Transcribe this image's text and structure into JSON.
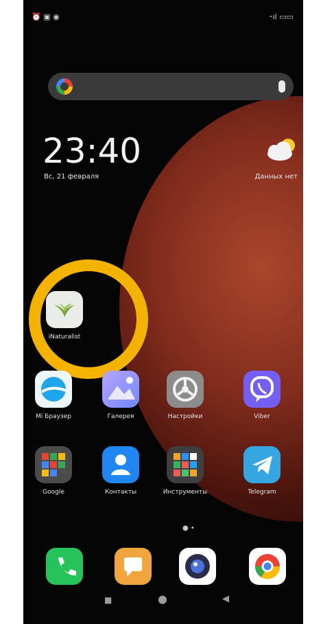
{
  "status_bar": {
    "left": "⏰ ▣ ◉",
    "right": "⁃ıl ▭▭"
  },
  "search": {
    "icon_left": "google-g-icon",
    "icon_right": "mic-icon"
  },
  "clock": {
    "time": "23:40",
    "date": "Вс, 21 февраля"
  },
  "weather": {
    "text": "Данных нет"
  },
  "apps": [
    {
      "label": "iNaturalist"
    },
    {
      "label": "Mi Браузер"
    },
    {
      "label": "Галерея"
    },
    {
      "label": "Настройки"
    },
    {
      "label": "Viber"
    },
    {
      "label": "Google"
    },
    {
      "label": "Контакты"
    },
    {
      "label": "Инструменты"
    },
    {
      "label": "Telegram"
    }
  ],
  "dock": [
    {
      "name": "phone"
    },
    {
      "name": "messages"
    },
    {
      "name": "camera"
    },
    {
      "name": "chrome"
    }
  ],
  "page_indicator": "● •",
  "nav": {
    "recent": "■",
    "home": "●",
    "back": "◀"
  },
  "colors": {
    "highlight_ring": "#f4b300"
  }
}
